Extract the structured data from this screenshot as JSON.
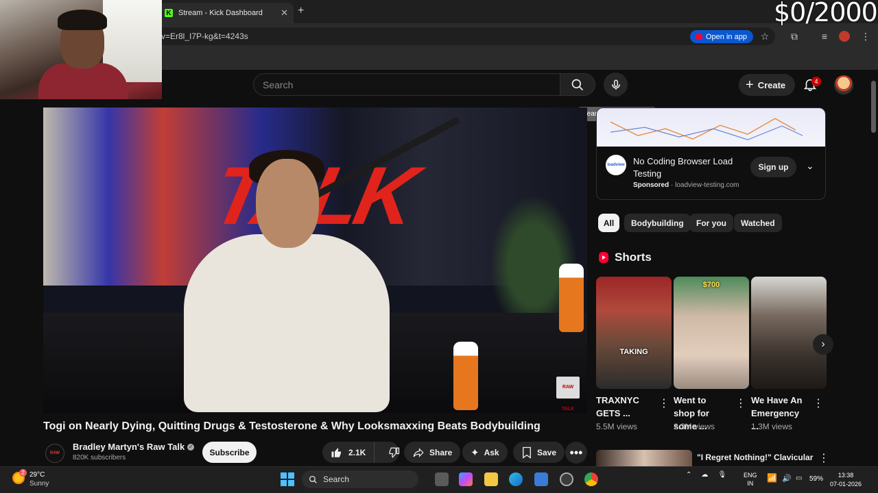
{
  "browser": {
    "tab_title": "Stream - Kick Dashboard",
    "url_fragment": "v=Er8l_I7P-kg&t=4243s",
    "open_in_app": "Open in app"
  },
  "overlay": {
    "counter": "$0/2000"
  },
  "header": {
    "search_placeholder": "Search",
    "mic_tooltip": "Search with your voice",
    "create_label": "Create",
    "notification_count": "4"
  },
  "video": {
    "title": "Togi on Nearly Dying, Quitting Drugs & Testosterone & Why Looksmaxxing Beats Bodybuilding",
    "channel": "Bradley Martyn's Raw Talk",
    "subscribers": "820K subscribers",
    "subscribe_label": "Subscribe",
    "likes": "2.1K",
    "share_label": "Share",
    "ask_label": "Ask",
    "save_label": "Save"
  },
  "ad": {
    "title": "No Coding Browser Load Testing",
    "sponsored": "Sponsored",
    "domain": "loadview-testing.com",
    "cta": "Sign up"
  },
  "chips": [
    "All",
    "Bodybuilding",
    "For you",
    "Watched"
  ],
  "shorts": {
    "heading": "Shorts",
    "items": [
      {
        "title": "TRAXNYC GETS ...",
        "views": "5.5M views",
        "caption": "TAKING"
      },
      {
        "title": "Went to shop for some ...",
        "views": "2.3M views",
        "caption": "$700"
      },
      {
        "title": "We Have An Emergency ...",
        "views": "1.3M views",
        "caption": ""
      }
    ]
  },
  "next_video": {
    "title": "\"I Regret Nothing!\" Clavicular"
  },
  "taskbar": {
    "temperature": "29°C",
    "condition": "Sunny",
    "weather_badge": "2",
    "search_label": "Search",
    "lang_top": "ENG",
    "lang_bottom": "IN",
    "battery": "59%",
    "time": "13:38",
    "date": "07-01-2026"
  },
  "colors": {
    "yt_red": "#ff0033",
    "kick_green": "#53fc18",
    "bg": "#0f0f0f"
  }
}
